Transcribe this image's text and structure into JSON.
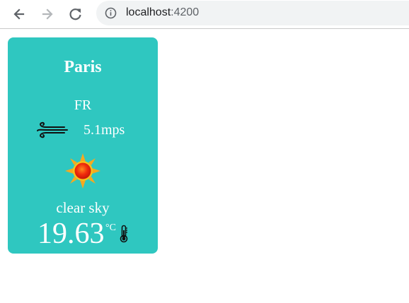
{
  "browser": {
    "url_host": "localhost",
    "url_port": ":4200",
    "back_icon": "arrow-left-icon",
    "forward_icon": "arrow-right-icon",
    "reload_icon": "reload-icon",
    "site_info_icon": "info-circle-icon"
  },
  "weather_card": {
    "city": "Paris",
    "country": "FR",
    "wind_speed": "5.1mps",
    "wind_icon": "wind-icon",
    "condition_icon": "sun-icon",
    "description": "clear sky",
    "temperature": "19.63",
    "temperature_unit": "°C",
    "thermometer_icon": "thermometer-icon",
    "background_color": "#2fc7c0"
  }
}
